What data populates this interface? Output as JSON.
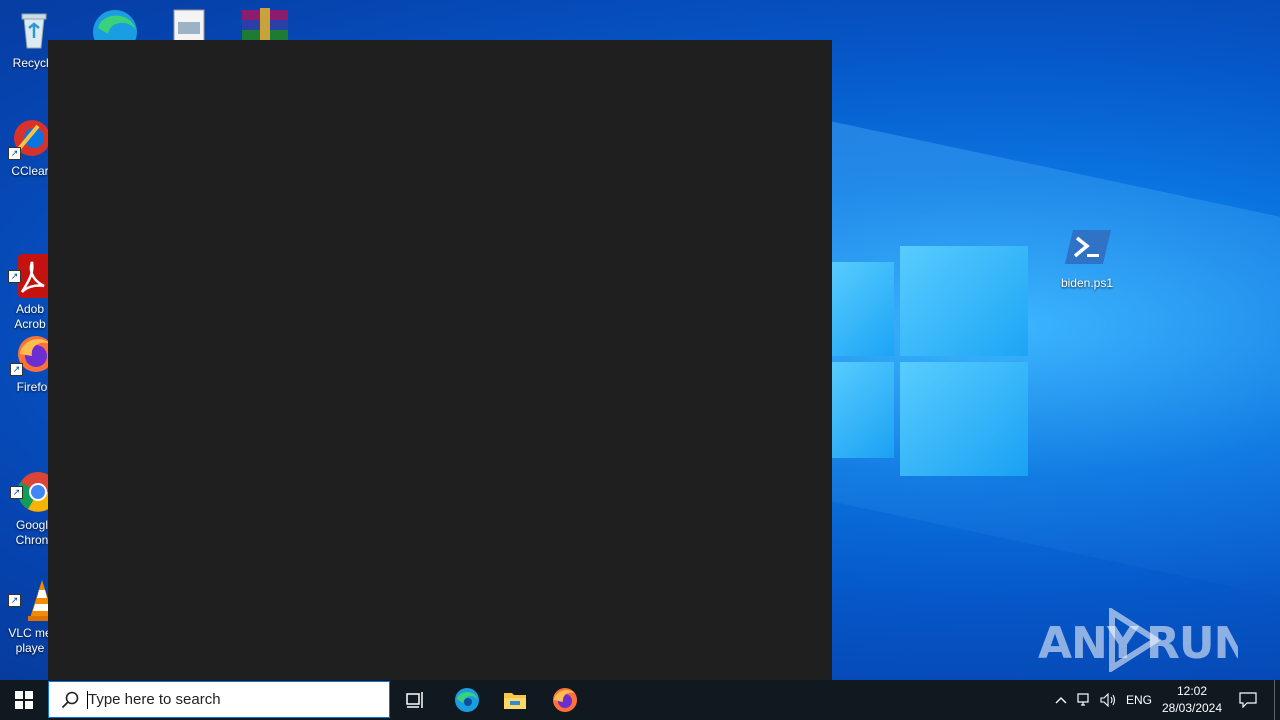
{
  "desktop": {
    "icons_left": [
      {
        "label": "Recycle",
        "icon": "recycle-bin-icon"
      },
      {
        "label": "CClear",
        "icon": "ccleaner-icon"
      },
      {
        "label": "Adob\nAcrob",
        "icon": "adobe-acrobat-icon"
      },
      {
        "label": "Firefo",
        "icon": "firefox-icon"
      },
      {
        "label": "Googl\nChron",
        "icon": "chrome-icon"
      },
      {
        "label": "VLC me\nplaye",
        "icon": "vlc-icon"
      }
    ],
    "icons_top": [
      {
        "icon": "edge-icon"
      },
      {
        "icon": "document-icon"
      },
      {
        "icon": "winrar-icon"
      }
    ],
    "file_icon": {
      "label": "biden.ps1",
      "icon": "powershell-script-icon"
    }
  },
  "watermark": "ANY RUN",
  "taskbar": {
    "search_placeholder": "Type here to search",
    "pinned": [
      {
        "name": "task-view-icon"
      },
      {
        "name": "edge-icon"
      },
      {
        "name": "file-explorer-icon"
      },
      {
        "name": "firefox-icon"
      }
    ],
    "tray": {
      "language": "ENG",
      "time": "12:02",
      "date": "28/03/2024"
    }
  },
  "colors": {
    "console_bg": "#1f1f1f",
    "taskbar_bg": "#101820",
    "desktop_accent": "#0a74e0"
  }
}
